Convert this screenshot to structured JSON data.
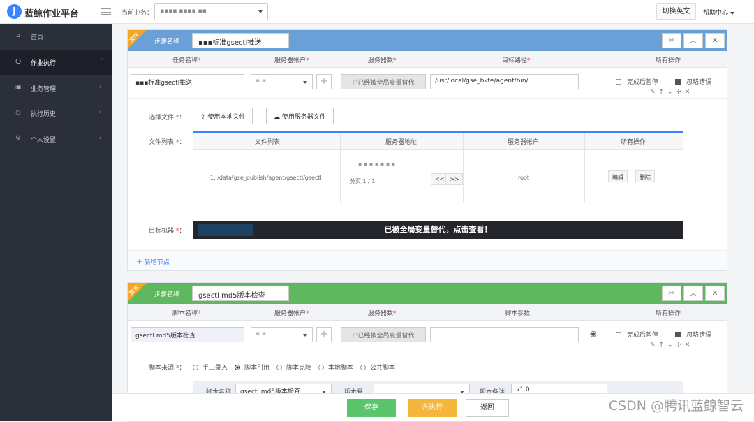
{
  "app": {
    "title": "蓝鲸作业平台",
    "logo_letter": "J"
  },
  "topbar": {
    "biz_label": "当前业务：",
    "biz_value": "▪▪▪▪ ▪▪▪▪ ▪▪",
    "switch_lang": "切换英文",
    "help": "帮助中心"
  },
  "sidebar": {
    "items": [
      {
        "label": "首页",
        "icon": "home-icon",
        "chev": ""
      },
      {
        "label": "作业执行",
        "icon": "circle-icon",
        "chev": "⌃",
        "active": true
      },
      {
        "label": "业务管理",
        "icon": "briefcase-icon",
        "chev": "›"
      },
      {
        "label": "执行历史",
        "icon": "clock-icon",
        "chev": "›"
      },
      {
        "label": "个人设置",
        "icon": "gear-icon",
        "chev": "›"
      }
    ]
  },
  "step1": {
    "corner": "文件",
    "name_label": "步骤名称",
    "name_value": "▪▪▪标准gsectl推送",
    "cols": {
      "task_name": "任务名称",
      "account": "服务器帐户",
      "servers": "服务器数",
      "target_path": "目标路径",
      "ops": "所有操作"
    },
    "row": {
      "task_name": "▪▪▪标准gsectl推送",
      "account": "▪ ▪",
      "servers": "IP已经被全局变量替代",
      "target_path": "/usr/local/gse_bkte/agent/bin/",
      "pause_label": "完成后暂停",
      "ignore_label": "忽略错误"
    },
    "select_file_label": "选择文件",
    "local_btn": "使用本地文件",
    "server_btn": "使用服务器文件",
    "file_list_label": "文件列表",
    "table": {
      "headers": [
        "文件列表",
        "服务器地址",
        "服务器帐户",
        "所有操作"
      ],
      "file": "1. /data/gse_publish/agent/gsectl/gsectl",
      "server_addr": "▪ ▪ ▪ ▪ ▪ ▪ ▪",
      "paging": "分页 1 / 1",
      "prev": "<<",
      "next": ">>",
      "account": "root",
      "edit": "编辑",
      "delete": "删除"
    },
    "target_label": "目标机器",
    "banner": "已被全局变量替代，点击查看！",
    "add_node": "新增节点"
  },
  "step2": {
    "corner": "脚本",
    "name_label": "步骤名称",
    "name_value": "gsectl md5版本检查",
    "cols": {
      "script_name": "脚本名称",
      "account": "服务器帐户",
      "servers": "服务器数",
      "params": "脚本参数",
      "ops": "所有操作"
    },
    "row": {
      "script_name": "gsectl md5版本检查",
      "account": "▪ ▪",
      "servers": "IP已经被全局变量替代",
      "params": "",
      "pause_label": "完成后暂停",
      "ignore_label": "忽略错误"
    },
    "source_label": "脚本来源",
    "sources": [
      "手工录入",
      "脚本引用",
      "脚本克隆",
      "本地脚本",
      "公共脚本"
    ],
    "sub": {
      "name_label": "脚本名称",
      "name_value": "gsectl md5版本检查",
      "ver_label": "版本号",
      "note_label": "版本备注",
      "note_value": "v1.0"
    }
  },
  "footer": {
    "save": "保存",
    "execute": "去执行",
    "back": "返回"
  },
  "watermark": "CSDN @腾讯蓝鲸智云"
}
